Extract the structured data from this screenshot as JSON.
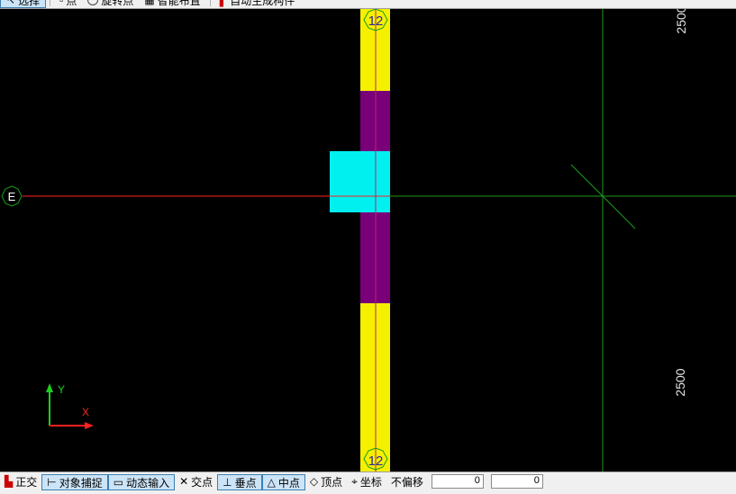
{
  "toolbar": {
    "items": [
      {
        "label": "选择",
        "icon": "select-arrow-icon",
        "active": true
      },
      {
        "label": "点",
        "icon": "point-icon",
        "active": false
      },
      {
        "label": "旋转点",
        "icon": "rotate-point-icon",
        "active": false
      },
      {
        "label": "智能布置",
        "icon": "smart-layout-icon",
        "active": false
      },
      {
        "label": "自动生成构件",
        "icon": "auto-generate-icon",
        "active": false
      }
    ]
  },
  "drawing": {
    "axis_labels": {
      "grid_e": "E",
      "grid_12_top": "12",
      "grid_12_bottom": "12"
    },
    "dimensions": {
      "top_right": "2500",
      "bottom_right": "2500"
    },
    "ucs": {
      "x_label": "X",
      "y_label": "Y"
    },
    "colors": {
      "background": "#000000",
      "beam": "#f5f000",
      "beam_mid": "#7a007a",
      "column": "#00f0f0",
      "axis_line": "#ff2020",
      "grid_line": "#1c9a1c",
      "axis_bubble": "#1c9a1c"
    }
  },
  "statusbar": {
    "items": [
      {
        "label": "正交",
        "icon": "ortho-icon",
        "active": false
      },
      {
        "label": "对象捕捉",
        "icon": "osnap-icon",
        "active": true
      },
      {
        "label": "动态输入",
        "icon": "dynamic-input-icon",
        "active": true
      },
      {
        "label": "交点",
        "icon": "intersection-icon",
        "active": false
      },
      {
        "label": "垂点",
        "icon": "perpendicular-icon",
        "active": true
      },
      {
        "label": "中点",
        "icon": "midpoint-icon",
        "active": true
      },
      {
        "label": "顶点",
        "icon": "vertex-icon",
        "active": false
      },
      {
        "label": "坐标",
        "icon": "coordinate-icon",
        "active": false
      },
      {
        "label": "不偏移",
        "icon": "no-offset-icon",
        "active": false
      }
    ],
    "x_value": "0",
    "y_value": "0"
  }
}
